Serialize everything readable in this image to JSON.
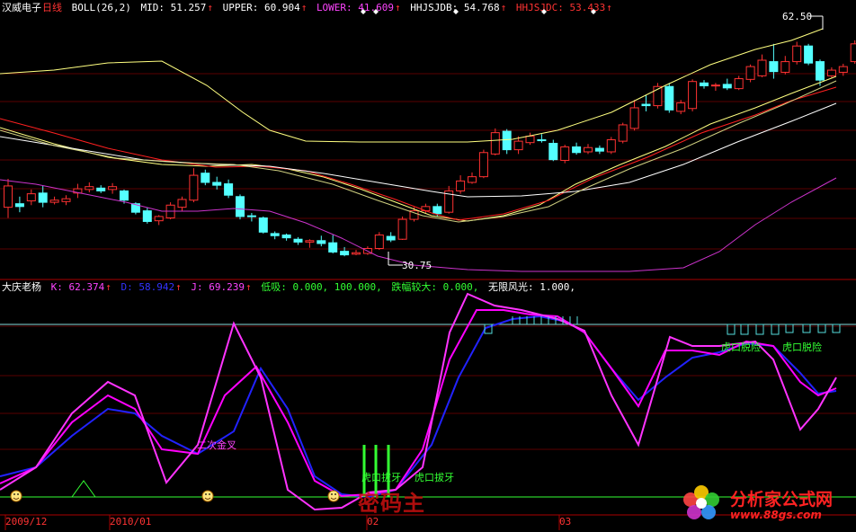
{
  "main_panel": {
    "stock_name": "汉威电子",
    "period": "日线",
    "indicator": "BOLL(26,2)",
    "mid": "MID: 51.257",
    "upper": "UPPER: 60.904",
    "lower": "LOWER: 41.609",
    "hhjsjdb": "HHJSJDB: 54.768",
    "hhjsjdc": "HHJSJDC: 53.433",
    "high_marker": "62.50",
    "low_marker": "30.75"
  },
  "sub_panel": {
    "indicator": "大庆老杨",
    "k": "K: 62.374",
    "d": "D: 58.942",
    "j": "J: 69.239",
    "dixi": "低吸: 0.000, 100.000,",
    "diefu": "跌幅较大: 0.000,",
    "wuxian": "无限风光: 1.000,",
    "annot_golden": "二次金叉",
    "annot_hukou1": "虎口拔牙",
    "annot_hukou2": "虎口拔牙",
    "annot_tuoxian1": "虎口脱险",
    "annot_tuoxian2": "虎口脱险"
  },
  "dates": [
    "2009/12",
    "2010/01",
    "02",
    "03"
  ],
  "watermark": {
    "left": "密码主",
    "right": "分析家公式网",
    "url": "www.88gs.com"
  },
  "colors": {
    "up": "#ff3232",
    "down": "#54ffff",
    "k_line": "#ff00ff",
    "d_line": "#2222ff",
    "j_line": "#ff33ff",
    "mid": "#ffff80",
    "upper": "#ffff80",
    "lower": "#cc33cc",
    "ma_red": "#ff2020",
    "ma_white": "#ffffff"
  },
  "chart_data": {
    "type": "candlestick",
    "candles": [
      [
        37.5,
        40.5,
        36.0,
        41.5
      ],
      [
        38.0,
        37.6,
        36.8,
        39.0
      ],
      [
        38.4,
        39.4,
        37.8,
        40.0
      ],
      [
        39.5,
        38.2,
        37.5,
        40.5
      ],
      [
        38.2,
        38.5,
        37.9,
        39.0
      ],
      [
        38.3,
        38.7,
        37.8,
        39.2
      ],
      [
        39.5,
        40.1,
        38.8,
        40.8
      ],
      [
        40.0,
        40.4,
        39.6,
        41.0
      ],
      [
        40.2,
        39.8,
        39.5,
        40.6
      ],
      [
        40.0,
        40.4,
        39.4,
        40.9
      ],
      [
        39.8,
        38.5,
        38.0,
        40.0
      ],
      [
        38.0,
        36.8,
        36.5,
        38.2
      ],
      [
        37.0,
        35.5,
        35.2,
        37.5
      ],
      [
        35.6,
        36.2,
        35.0,
        36.4
      ],
      [
        36.0,
        37.8,
        35.8,
        38.2
      ],
      [
        37.5,
        38.6,
        37.0,
        39.0
      ],
      [
        38.5,
        42.0,
        38.2,
        43.0
      ],
      [
        42.3,
        41.0,
        40.6,
        42.8
      ],
      [
        41.0,
        40.6,
        40.0,
        41.8
      ],
      [
        40.8,
        39.2,
        38.8,
        41.4
      ],
      [
        39.0,
        36.2,
        35.8,
        39.3
      ],
      [
        36.3,
        36.2,
        35.5,
        36.7
      ],
      [
        36.0,
        34.0,
        33.8,
        36.2
      ],
      [
        33.8,
        33.5,
        33.0,
        34.1
      ],
      [
        33.6,
        33.2,
        32.8,
        33.8
      ],
      [
        33.0,
        32.6,
        32.2,
        33.3
      ],
      [
        32.6,
        32.8,
        31.8,
        33.0
      ],
      [
        32.8,
        32.4,
        32.0,
        33.5
      ],
      [
        32.5,
        31.2,
        31.0,
        33.6
      ],
      [
        31.3,
        30.8,
        30.6,
        31.9
      ],
      [
        30.9,
        31.1,
        30.75,
        31.5
      ],
      [
        31.0,
        31.7,
        30.8,
        32.0
      ],
      [
        31.7,
        33.6,
        31.5,
        34.0
      ],
      [
        33.4,
        32.9,
        32.6,
        34.0
      ],
      [
        33.0,
        35.8,
        32.9,
        36.2
      ],
      [
        35.8,
        37.0,
        35.5,
        37.5
      ],
      [
        37.0,
        37.6,
        36.7,
        38.0
      ],
      [
        37.6,
        36.6,
        36.2,
        38.0
      ],
      [
        36.8,
        39.8,
        36.6,
        40.5
      ],
      [
        39.8,
        41.2,
        39.4,
        42.0
      ],
      [
        41.0,
        41.8,
        40.8,
        42.4
      ],
      [
        41.8,
        45.2,
        41.6,
        45.6
      ],
      [
        45.0,
        48.0,
        44.8,
        48.6
      ],
      [
        48.2,
        45.6,
        45.0,
        48.5
      ],
      [
        45.6,
        46.8,
        45.0,
        47.5
      ],
      [
        46.6,
        47.5,
        46.3,
        48.0
      ],
      [
        47.0,
        46.9,
        46.6,
        47.8
      ],
      [
        46.5,
        44.2,
        44.0,
        47.0
      ],
      [
        44.1,
        46.0,
        43.7,
        46.3
      ],
      [
        46.0,
        45.2,
        44.9,
        46.6
      ],
      [
        45.3,
        45.9,
        45.0,
        46.4
      ],
      [
        45.8,
        45.4,
        45.0,
        46.2
      ],
      [
        45.3,
        47.0,
        45.0,
        47.4
      ],
      [
        46.8,
        49.1,
        46.5,
        49.4
      ],
      [
        48.6,
        51.5,
        48.3,
        52.6
      ],
      [
        52.0,
        51.8,
        51.0,
        53.3
      ],
      [
        51.8,
        54.5,
        51.4,
        55.0
      ],
      [
        54.5,
        51.2,
        50.8,
        55.0
      ],
      [
        51.0,
        52.2,
        50.6,
        52.6
      ],
      [
        51.4,
        55.2,
        51.0,
        55.5
      ],
      [
        55.0,
        54.6,
        54.2,
        55.4
      ],
      [
        54.6,
        54.7,
        53.9,
        55.0
      ],
      [
        54.8,
        54.3,
        54.0,
        55.6
      ],
      [
        54.2,
        55.6,
        54.0,
        56.0
      ],
      [
        55.5,
        57.3,
        55.1,
        57.6
      ],
      [
        56.0,
        58.2,
        55.8,
        59.0
      ],
      [
        58.0,
        56.6,
        55.6,
        60.5
      ],
      [
        56.5,
        58.0,
        56.2,
        58.8
      ],
      [
        58.0,
        60.2,
        57.6,
        60.8
      ],
      [
        60.2,
        57.8,
        57.5,
        60.5
      ],
      [
        58.0,
        55.4,
        54.6,
        58.3
      ],
      [
        56.0,
        56.8,
        55.7,
        57.2
      ],
      [
        56.5,
        57.3,
        56.0,
        57.7
      ],
      [
        58.0,
        60.5,
        57.7,
        61.0
      ],
      [
        60.5,
        60.7,
        60.2,
        62.5
      ],
      [
        61.0,
        58.6,
        58.2,
        61.5
      ]
    ]
  }
}
